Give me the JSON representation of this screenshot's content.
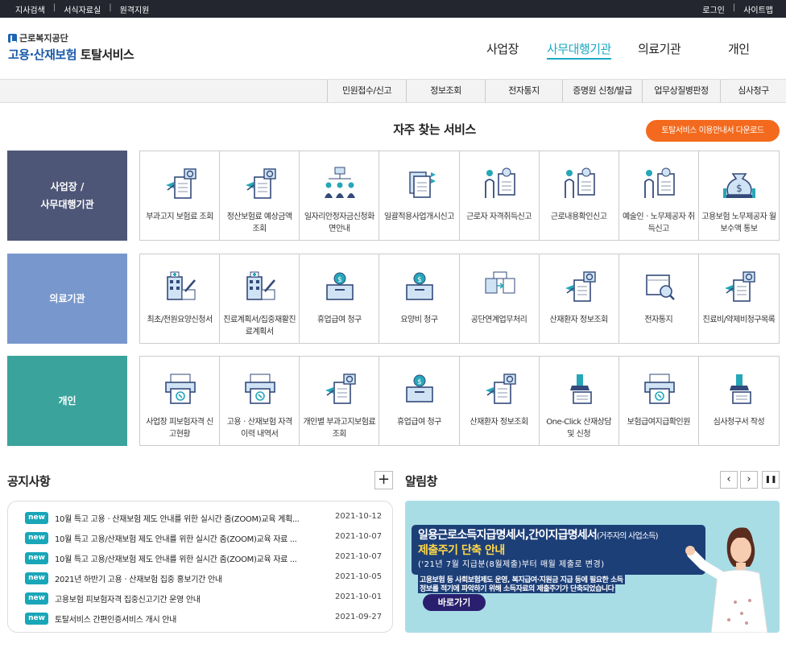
{
  "topbar": {
    "left": [
      "지사검색",
      "서식자료실",
      "원격지원"
    ],
    "right": [
      "로그인",
      "사이트맵"
    ]
  },
  "logo": {
    "org": "근로복지공단",
    "service_blue": "고용·산재보험",
    "service_black": " 토탈서비스"
  },
  "main_nav": [
    "사업장",
    "사무대행기관",
    "의료기관",
    "개인"
  ],
  "main_nav_active": "사무대행기관",
  "sub_nav": [
    "민원접수/신고",
    "정보조회",
    "전자통지",
    "증명원 신청/발급",
    "업무상질병판정",
    "심사청구"
  ],
  "frequent": {
    "title": "자주 찾는 서비스",
    "download_button": "토탈서비스 이용안내서 다운로드",
    "categories": [
      {
        "name": "사업장 /\n사무대행기관",
        "color": "#4e5677",
        "items": [
          {
            "label": "부과고지 보험료 조회",
            "icon": "document-search-icon"
          },
          {
            "label": "정산보험료 예상금액 조회",
            "icon": "document-search-icon"
          },
          {
            "label": "일자리안정자금신청화면안내",
            "icon": "org-chart-icon"
          },
          {
            "label": "일괄적용사업개시신고",
            "icon": "documents-icon"
          },
          {
            "label": "근로자 자격취득신고",
            "icon": "person-document-icon"
          },
          {
            "label": "근로내용확인신고",
            "icon": "person-document-icon"
          },
          {
            "label": "예술인ㆍ노무제공자 취득신고",
            "icon": "person-document-icon"
          },
          {
            "label": "고용보험 노무제공자 월보수액 통보",
            "icon": "money-bag-icon"
          }
        ]
      },
      {
        "name": "의료기관",
        "color": "#7898cd",
        "items": [
          {
            "label": "최초/전원요양신청서",
            "icon": "hospital-pen-icon"
          },
          {
            "label": "진료계획서/집중재활진료계획서",
            "icon": "hospital-pen-icon"
          },
          {
            "label": "휴업급여 청구",
            "icon": "coin-box-icon"
          },
          {
            "label": "요양비 청구",
            "icon": "coin-box-icon"
          },
          {
            "label": "공단연계업무처리",
            "icon": "transfer-icon"
          },
          {
            "label": "산재환자 정보조회",
            "icon": "document-search-icon"
          },
          {
            "label": "전자통지",
            "icon": "box-search-icon"
          },
          {
            "label": "진료비/약제비청구목록",
            "icon": "document-search-icon"
          }
        ]
      },
      {
        "name": "개인",
        "color": "#3aa39c",
        "items": [
          {
            "label": "사업장 피보험자격 신고현황",
            "icon": "printer-icon"
          },
          {
            "label": "고용ㆍ산재보험 자격 이력 내역서",
            "icon": "printer-icon"
          },
          {
            "label": "개인별 부과고지보험료 조회",
            "icon": "document-search-icon"
          },
          {
            "label": "휴업급여 청구",
            "icon": "coin-box-icon"
          },
          {
            "label": "산재환자 정보조회",
            "icon": "document-search-icon"
          },
          {
            "label": "One-Click 산재상담 및 신청",
            "icon": "stamp-icon"
          },
          {
            "label": "보험급여지급확인원",
            "icon": "printer-icon"
          },
          {
            "label": "심사청구서 작성",
            "icon": "stamp-icon"
          }
        ]
      }
    ]
  },
  "notice": {
    "title": "공지사항",
    "more": "+",
    "badge": "new",
    "items": [
      {
        "text": "10월 특고 고용ㆍ산재보험 제도 안내를 위한 실시간 줌(ZOOM)교육 계획...",
        "date": "2021-10-12"
      },
      {
        "text": "10월 특고 고용/산재보험 제도 안내를 위한 실시간 줌(ZOOM)교육 자료 ...",
        "date": "2021-10-07"
      },
      {
        "text": "10월 특고 고용/산재보험 제도 안내를 위한 실시간 줌(ZOOM)교육 자료 ...",
        "date": "2021-10-07"
      },
      {
        "text": "2021년 하반기 고용ㆍ산재보험 집중 홍보기간 안내",
        "date": "2021-10-05"
      },
      {
        "text": "고용보험 피보험자격 집중신고기간 운영 안내",
        "date": "2021-10-01"
      },
      {
        "text": "토탈서비스 간편인증서비스 개시 안내",
        "date": "2021-09-27"
      }
    ]
  },
  "alarm": {
    "title": "알림창",
    "prev": "‹",
    "next": "›",
    "pause": "❚❚",
    "banner": {
      "headline": "일용근로소득지급명세서,간이지급명세서",
      "headline_small": "(거주자의 사업소득)",
      "subhead": "제출주기 단축 안내",
      "period": "('21년 7월 지급분(8월제출)부터 매월 제출로 변경)",
      "desc1": "고용보험 등 사회보험제도 운영, 복지급여·지원금 지급 등에 필요한 소득",
      "desc2": "정보를 적기에 파악하기 위해 소득자료의 제출주기가 단축되었습니다",
      "go_button": "바로가기"
    }
  }
}
